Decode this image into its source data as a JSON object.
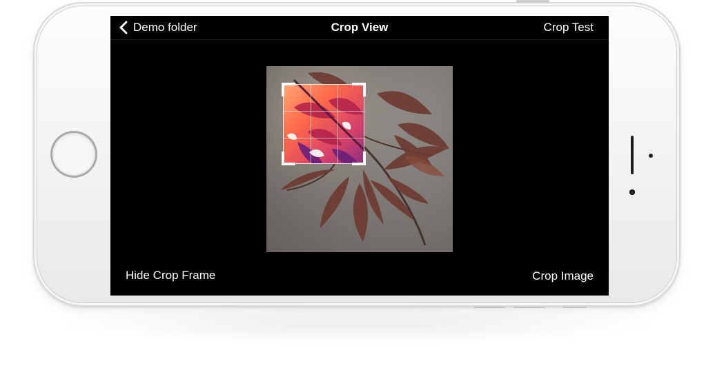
{
  "nav": {
    "back_label": "Demo folder",
    "back_icon": "chevron-left-icon",
    "title": "Crop View",
    "right_label": "Crop Test"
  },
  "toolbar": {
    "left_label": "Hide Crop Frame",
    "right_label": "Crop Image"
  },
  "photo": {
    "subject": "autumn leaves photo",
    "crop_grid": "3x3"
  },
  "colors": {
    "screen_background": "#000000",
    "text": "#ffffff",
    "phone_body": "#f2f2f3",
    "crop_accent_warm": "#ff7a3c",
    "crop_accent_cool": "#9b2f8f"
  }
}
